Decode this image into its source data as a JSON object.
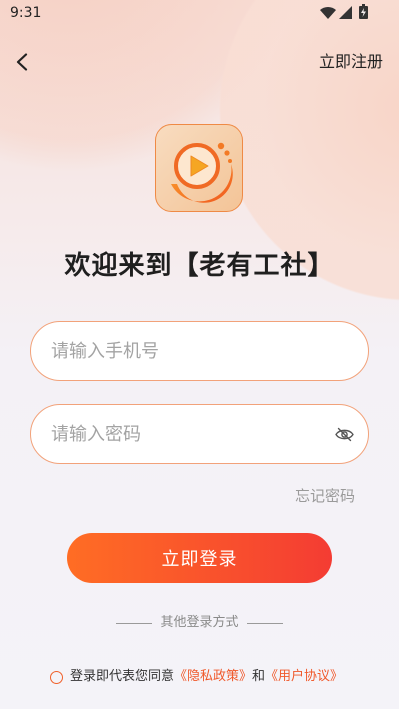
{
  "status_bar": {
    "time": "9:31",
    "icons": [
      "wifi-icon",
      "signal-icon",
      "battery-icon"
    ]
  },
  "header": {
    "back_icon": "back-arrow-icon",
    "register_label": "立即注册"
  },
  "logo": {
    "icon": "app-logo-play-icon"
  },
  "title": "欢迎来到【老有工社】",
  "form": {
    "phone_placeholder": "请输入手机号",
    "password_placeholder": "请输入密码",
    "password_toggle_icon": "eye-off-icon",
    "forgot_password_label": "忘记密码",
    "login_button_label": "立即登录"
  },
  "other_login": {
    "label": "其他登录方式"
  },
  "agreement": {
    "checked": false,
    "prefix": "登录即代表您同意",
    "privacy_link": "《隐私政策》",
    "conjunction": "和",
    "terms_link": "《用户协议》"
  },
  "colors": {
    "accent": "#f0602a",
    "button_gradient_start": "#ff6d24",
    "button_gradient_end": "#f43c33",
    "input_border": "#f2a27a",
    "link": "#f0592b",
    "background": "#f4f3f8"
  }
}
